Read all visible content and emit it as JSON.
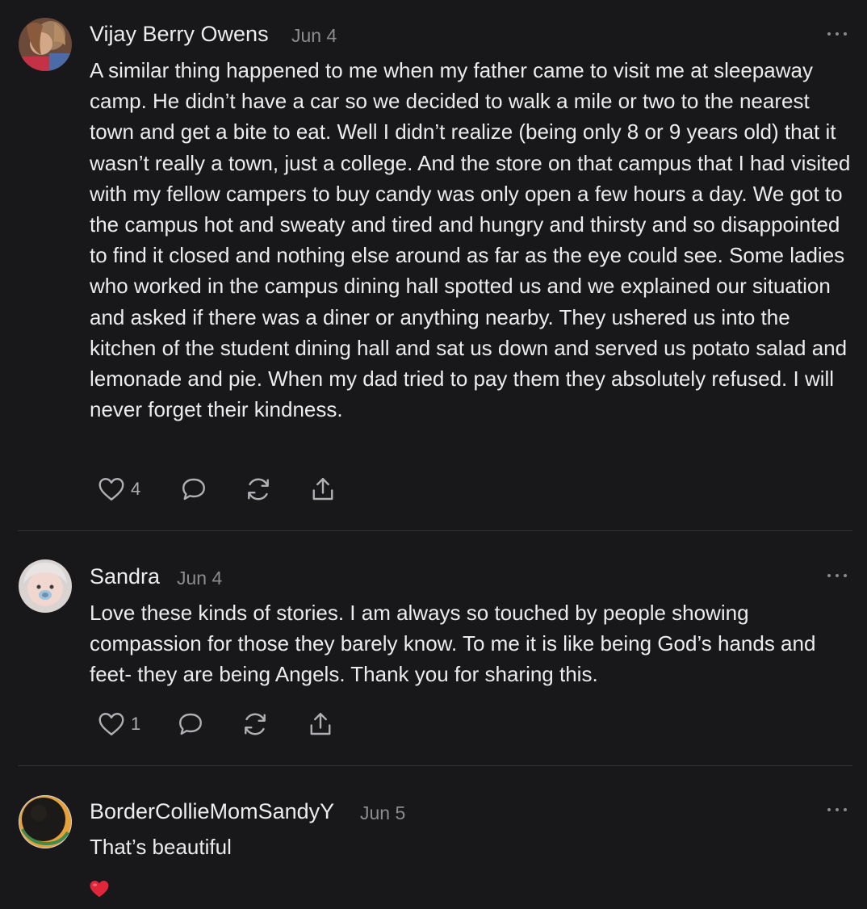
{
  "comments": [
    {
      "author": "Vijay Berry Owens",
      "date": "Jun 4",
      "text": "A similar thing happened to me when my father came to visit me at sleepaway camp. He didn’t have a car so we decided to walk a mile or two to the nearest town and get a bite to eat. Well I didn’t realize (being only 8 or 9 years old) that it wasn’t really a town, just a college. And the store on that campus that I had visited with my fellow campers to buy candy was only open a few hours a day. We got to the campus hot and sweaty and tired and hungry and thirsty and so disappointed to find it closed and nothing else around as far as the eye could see. Some ladies who worked in the campus dining hall spotted us and we explained our situation and asked if there was a diner or anything nearby. They ushered us into the kitchen of the student dining hall and sat us down and served us potato salad and lemonade and pie. When my dad tried to pay them they absolutely refused. I will never forget their kindness.",
      "likes": "4"
    },
    {
      "author": "Sandra",
      "date": "Jun 4",
      "text": "Love these kinds of stories. I am always so touched by people showing compassion for those they barely know. To me it is like being God’s hands and feet- they are being Angels. Thank you for sharing this.",
      "likes": "1"
    },
    {
      "author": "BorderCollieMomSandyY",
      "date": "Jun 5",
      "text": "That’s beautiful",
      "emoji": "heart-emoji"
    }
  ],
  "icons": {
    "like": "heart-outline-icon",
    "reply": "speech-bubble-icon",
    "restack": "refresh-arrows-icon",
    "share": "share-upload-icon",
    "more": "ellipsis-icon"
  },
  "colors": {
    "background": "#18181a",
    "text": "#ececed",
    "muted": "#8c8c90",
    "divider": "#333336",
    "heart": "#e0263a"
  }
}
